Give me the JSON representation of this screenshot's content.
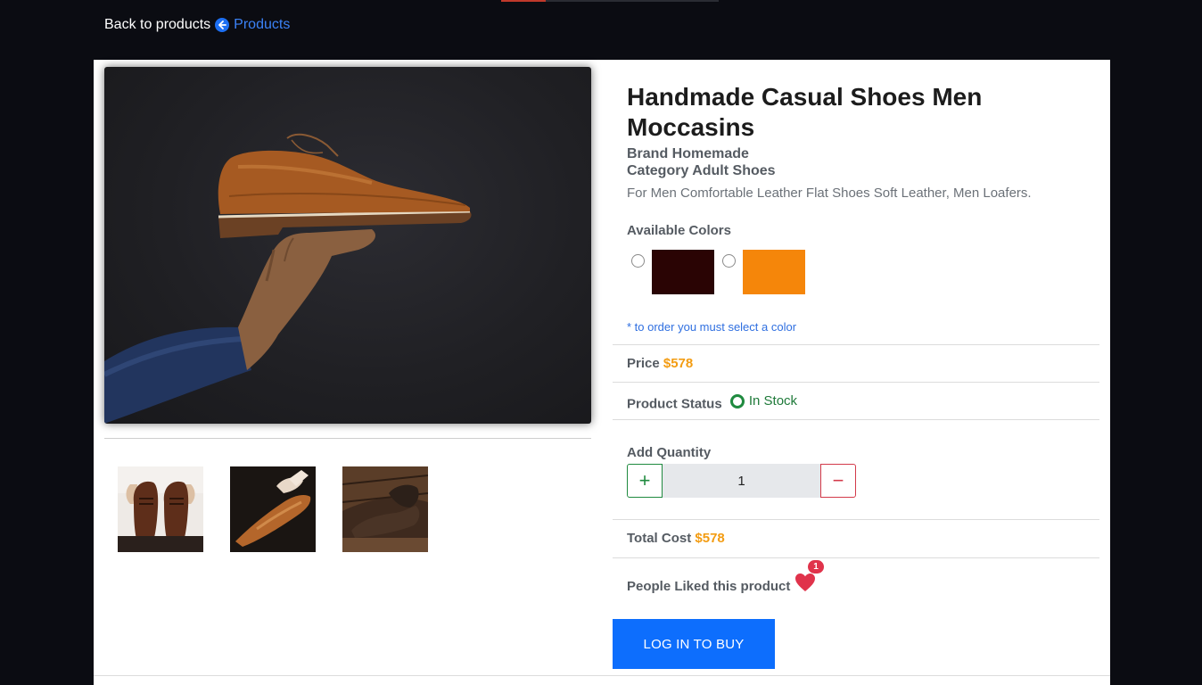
{
  "nav": {
    "back_text": "Back to products",
    "back_link": "Products"
  },
  "product": {
    "title": "Handmade Casual Shoes Men Moccasins",
    "brand": "Brand Homemade",
    "category": "Category Adult Shoes",
    "description": "For Men Comfortable Leather Flat Shoes Soft Leather, Men Loafers."
  },
  "colors": {
    "label": "Available Colors",
    "options": [
      "#2a0404",
      "#f5860a"
    ],
    "note": "* to order you must select a color"
  },
  "price": {
    "label": "Price",
    "value": "$578"
  },
  "status": {
    "label": "Product Status",
    "value": "In Stock",
    "color": "#1f7a3a"
  },
  "quantity": {
    "label": "Add Quantity",
    "value": "1",
    "plus": "+",
    "minus": "−"
  },
  "total": {
    "label": "Total Cost",
    "value": "$578"
  },
  "likes": {
    "label": "People Liked this product",
    "count": "1"
  },
  "buy_button": "LOG IN TO BUY",
  "icons": {
    "back": "arrow-left-circle-icon",
    "status": "radio-dot-icon",
    "like": "heart-icon"
  },
  "accent": {
    "primary": "#0d6efd",
    "price": "#f39c12",
    "danger": "#d33a4a"
  }
}
